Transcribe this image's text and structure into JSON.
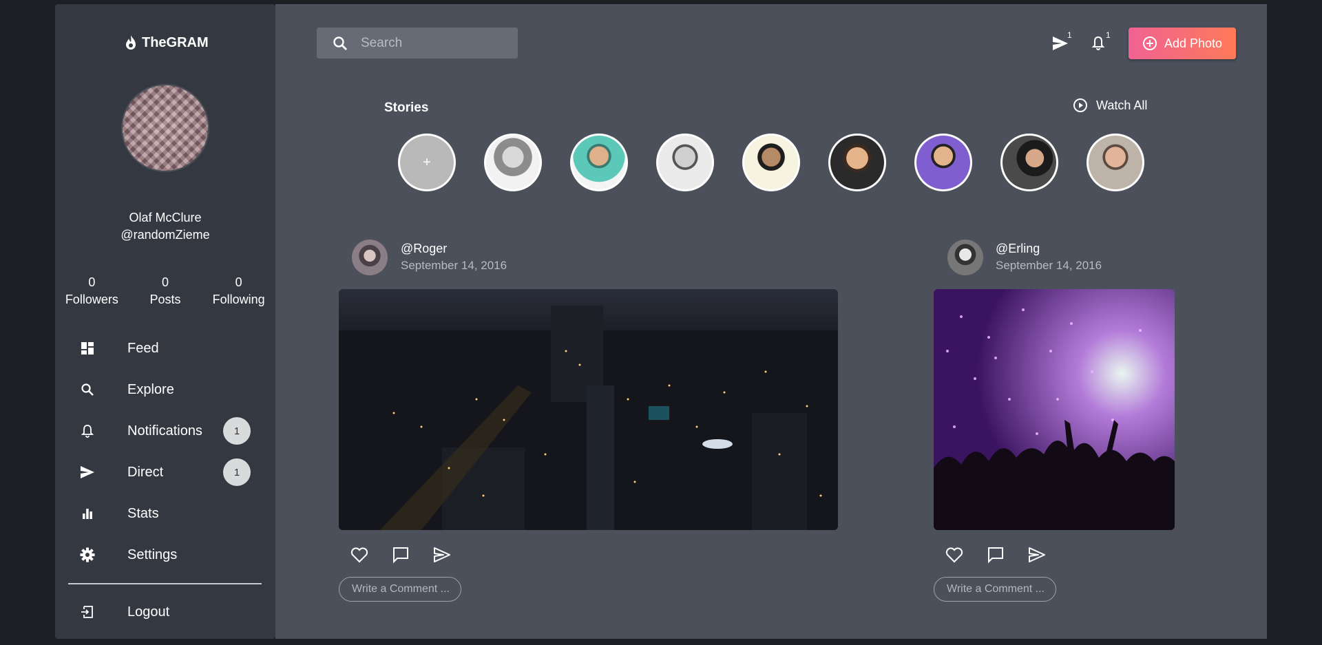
{
  "app": {
    "name": "TheGRAM"
  },
  "profile": {
    "name": "Olaf McClure",
    "handle": "@randomZieme"
  },
  "stats": [
    {
      "value": "0",
      "label": "Followers"
    },
    {
      "value": "0",
      "label": "Posts"
    },
    {
      "value": "0",
      "label": "Following"
    }
  ],
  "nav": {
    "feed": "Feed",
    "explore": "Explore",
    "notifications": "Notifications",
    "notifications_badge": "1",
    "direct": "Direct",
    "direct_badge": "1",
    "stats": "Stats",
    "settings": "Settings",
    "logout": "Logout"
  },
  "header": {
    "search_placeholder": "Search",
    "direct_count": "1",
    "notification_count": "1",
    "add_photo": "Add Photo"
  },
  "stories": {
    "title": "Stories",
    "watch_all": "Watch All",
    "add": "+"
  },
  "posts": [
    {
      "user": "@Roger",
      "date": "September 14, 2016",
      "comment_placeholder": "Write a Comment ..."
    },
    {
      "user": "@Erling",
      "date": "September 14, 2016",
      "comment_placeholder": "Write a Comment ..."
    }
  ],
  "colors": {
    "sidebar": "#343840",
    "main": "#4b505b",
    "accent_start": "#f06292",
    "accent_end": "#ff7a59"
  }
}
